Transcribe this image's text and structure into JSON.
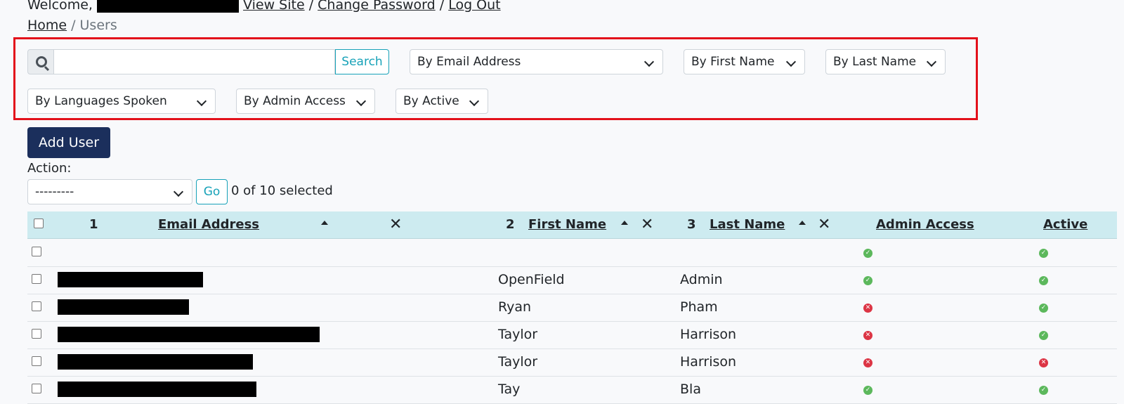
{
  "header": {
    "welcome": "Welcome,",
    "view_site": "View Site",
    "change_password": "Change Password",
    "log_out": "Log Out",
    "separator": "/"
  },
  "breadcrumb": {
    "home": "Home",
    "separator": "/",
    "current": "Users"
  },
  "filters": {
    "search_button": "Search",
    "search_value": "",
    "by_email": "By Email Address",
    "by_first_name": "By First Name",
    "by_last_name": "By Last Name",
    "by_languages": "By Languages Spoken",
    "by_admin": "By Admin Access",
    "by_active": "By Active"
  },
  "actions": {
    "add_user": "Add User",
    "action_label": "Action:",
    "action_select": "---------",
    "go": "Go",
    "selected_count": "0 of 10 selected"
  },
  "table": {
    "columns": {
      "email_index": "1",
      "email": "Email Address",
      "first_index": "2",
      "first_name": "First Name",
      "last_index": "3",
      "last_name": "Last Name",
      "admin": "Admin Access",
      "active": "Active",
      "remove": "✕"
    },
    "rows": [
      {
        "first_name": "",
        "last_name": "",
        "admin": true,
        "active": true
      },
      {
        "first_name": "OpenField",
        "last_name": "Admin",
        "admin": true,
        "active": true
      },
      {
        "first_name": "Ryan",
        "last_name": "Pham",
        "admin": false,
        "active": true
      },
      {
        "first_name": "Taylor",
        "last_name": "Harrison",
        "admin": false,
        "active": true
      },
      {
        "first_name": "Taylor",
        "last_name": "Harrison",
        "admin": false,
        "active": false
      },
      {
        "first_name": "Tay",
        "last_name": "Bla",
        "admin": true,
        "active": true
      }
    ],
    "icons": {
      "yes": "✓",
      "no": "✕"
    }
  },
  "colors": {
    "primary": "#1b2f5c",
    "accent": "#17a2b8",
    "highlight": "#e3111b",
    "header_bg": "#cdebf0"
  }
}
